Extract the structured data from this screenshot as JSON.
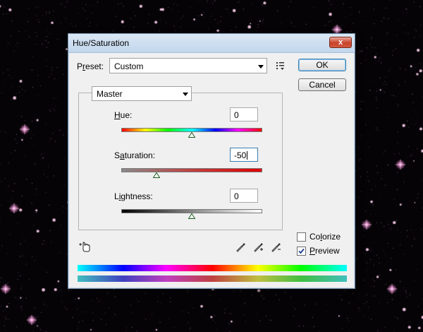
{
  "window": {
    "title": "Hue/Saturation",
    "close_label": "x"
  },
  "preset": {
    "label": "Preset:",
    "value": "Custom"
  },
  "buttons": {
    "ok": "OK",
    "cancel": "Cancel"
  },
  "channel": {
    "value": "Master"
  },
  "sliders": {
    "hue": {
      "label": "Hue:",
      "value": "0",
      "min": -180,
      "max": 180,
      "level": 0
    },
    "saturation": {
      "label": "Saturation:",
      "value": "-50",
      "min": -100,
      "max": 100,
      "level": -50
    },
    "lightness": {
      "label": "Lightness:",
      "value": "0",
      "min": -100,
      "max": 100,
      "level": 0
    }
  },
  "options": {
    "colorize": {
      "label": "Colorize",
      "checked": false
    },
    "preview": {
      "label": "Preview",
      "checked": true
    }
  },
  "icons": {
    "targeted_adjustment": "hand-adjust-icon",
    "eyedropper": "eyedropper-icon",
    "eyedropper_add": "eyedropper-plus-icon",
    "eyedropper_subtract": "eyedropper-minus-icon",
    "preset_menu": "preset-options-icon"
  },
  "colors": {
    "title_bar": "#c8daee",
    "close_button": "#c8432a",
    "dialog_bg": "#f0f0f0"
  }
}
